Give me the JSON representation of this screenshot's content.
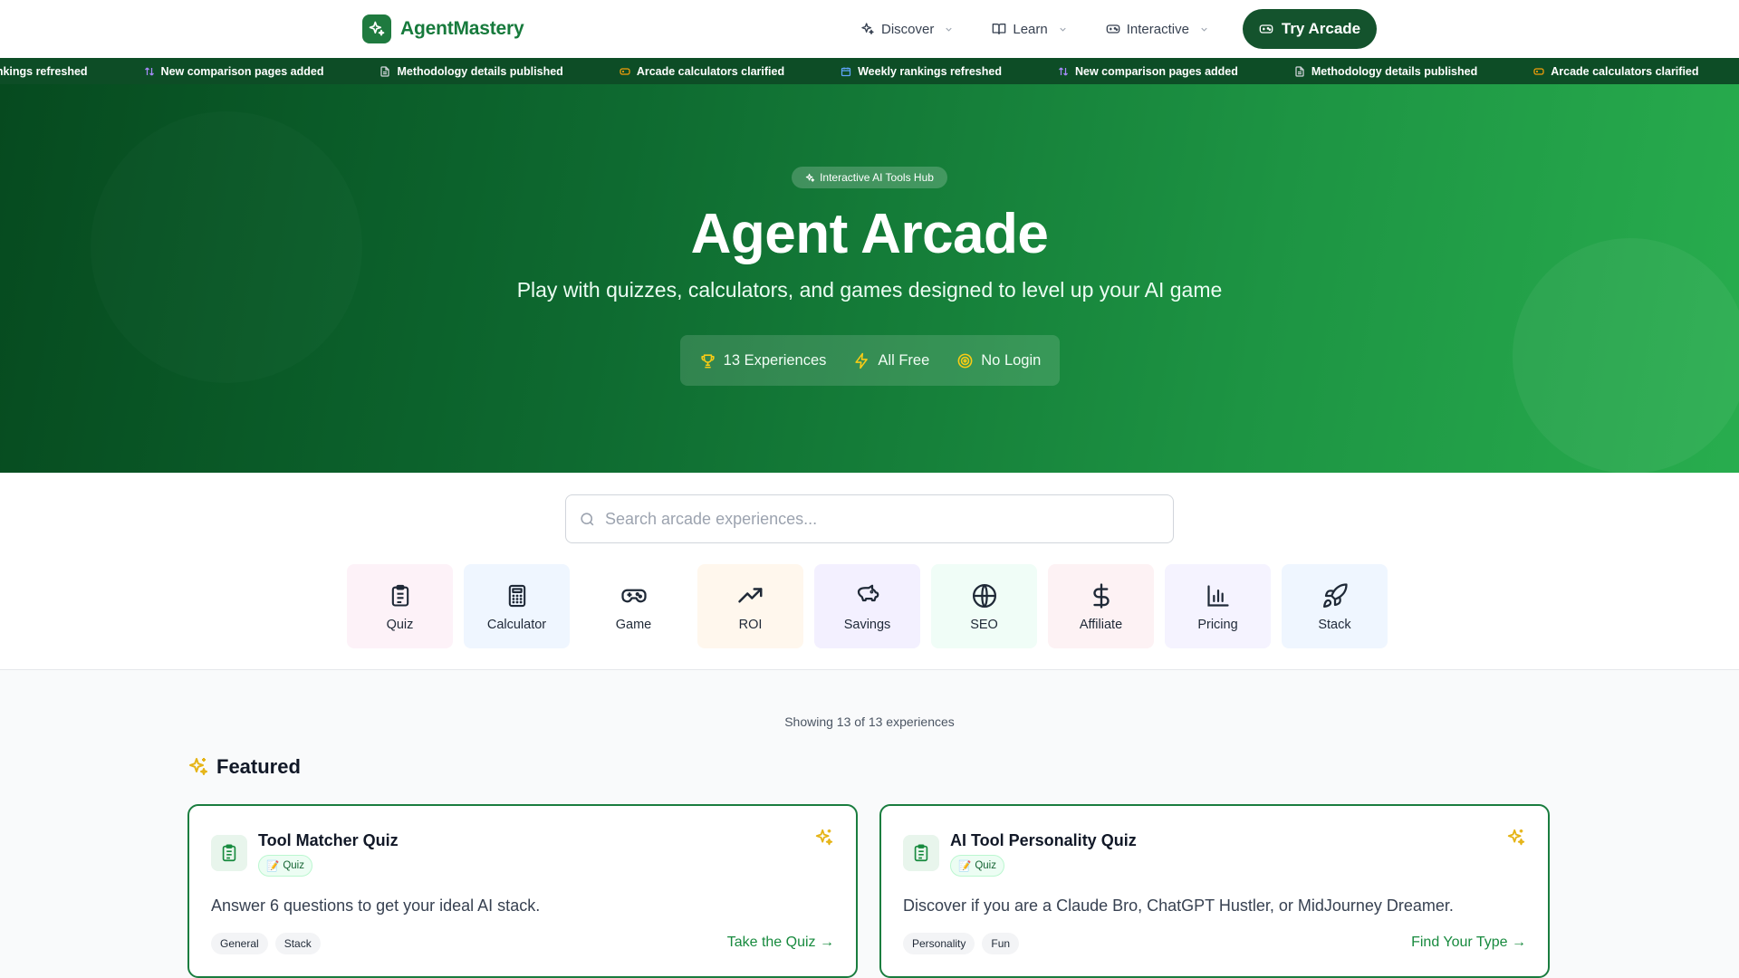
{
  "header": {
    "brand": "AgentMastery",
    "nav": [
      {
        "label": "Discover",
        "icon": "sparkles-icon"
      },
      {
        "label": "Learn",
        "icon": "book-icon"
      },
      {
        "label": "Interactive",
        "icon": "gamepad-icon"
      }
    ],
    "cta_label": "Try Arcade"
  },
  "ticker": {
    "items": [
      {
        "text": "rankings refreshed",
        "icon": "calendar-icon"
      },
      {
        "text": "New comparison pages added",
        "icon": "compare-icon"
      },
      {
        "text": "Methodology details published",
        "icon": "document-icon"
      },
      {
        "text": "Arcade calculators clarified",
        "icon": "gamepad-icon"
      },
      {
        "text": "Weekly rankings refreshed",
        "icon": "calendar-icon"
      },
      {
        "text": "New comparison pages added",
        "icon": "compare-icon"
      },
      {
        "text": "Methodology details published",
        "icon": "document-icon"
      },
      {
        "text": "Arcade calculators clarified",
        "icon": "gamepad-icon"
      }
    ]
  },
  "hero": {
    "badge": "Interactive AI Tools Hub",
    "title": "Agent Arcade",
    "subtitle": "Play with quizzes, calculators, and games designed to level up your AI game",
    "stats": [
      {
        "label": "13 Experiences",
        "icon": "trophy-icon"
      },
      {
        "label": "All Free",
        "icon": "lightning-icon"
      },
      {
        "label": "No Login",
        "icon": "target-icon"
      }
    ]
  },
  "search": {
    "placeholder": "Search arcade experiences..."
  },
  "categories": [
    {
      "label": "Quiz",
      "icon": "clipboard-icon",
      "bg": "#fdf2f8"
    },
    {
      "label": "Calculator",
      "icon": "calculator-icon",
      "bg": "#eff6ff"
    },
    {
      "label": "Game",
      "icon": "gamepad-icon",
      "bg": "#ffffff"
    },
    {
      "label": "ROI",
      "icon": "trending-up-icon",
      "bg": "#fff7ed"
    },
    {
      "label": "Savings",
      "icon": "piggy-bank-icon",
      "bg": "#f3f0ff"
    },
    {
      "label": "SEO",
      "icon": "globe-icon",
      "bg": "#f0fdf7"
    },
    {
      "label": "Affiliate",
      "icon": "dollar-icon",
      "bg": "#fdf2f4"
    },
    {
      "label": "Pricing",
      "icon": "bar-chart-icon",
      "bg": "#f5f3ff"
    },
    {
      "label": "Stack",
      "icon": "rocket-icon",
      "bg": "#eff6ff"
    }
  ],
  "results": {
    "showing_text": "Showing 13 of 13 experiences"
  },
  "featured": {
    "heading": "Featured",
    "cards": [
      {
        "title": "Tool Matcher Quiz",
        "tag": "Quiz",
        "tag_emoji": "📝",
        "description": "Answer 6 questions to get your ideal AI stack.",
        "chips": [
          "General",
          "Stack"
        ],
        "cta": "Take the Quiz →"
      },
      {
        "title": "AI Tool Personality Quiz",
        "tag": "Quiz",
        "tag_emoji": "📝",
        "description": "Discover if you are a Claude Bro, ChatGPT Hustler, or MidJourney Dreamer.",
        "chips": [
          "Personality",
          "Fun"
        ],
        "cta": "Find Your Type →"
      }
    ]
  },
  "colors": {
    "brand": "#177a3c",
    "hero_start": "#064a1f",
    "hero_end": "#28ad4e",
    "ticker_bg": "#0d4d26",
    "accent_gold": "#e5b416"
  }
}
